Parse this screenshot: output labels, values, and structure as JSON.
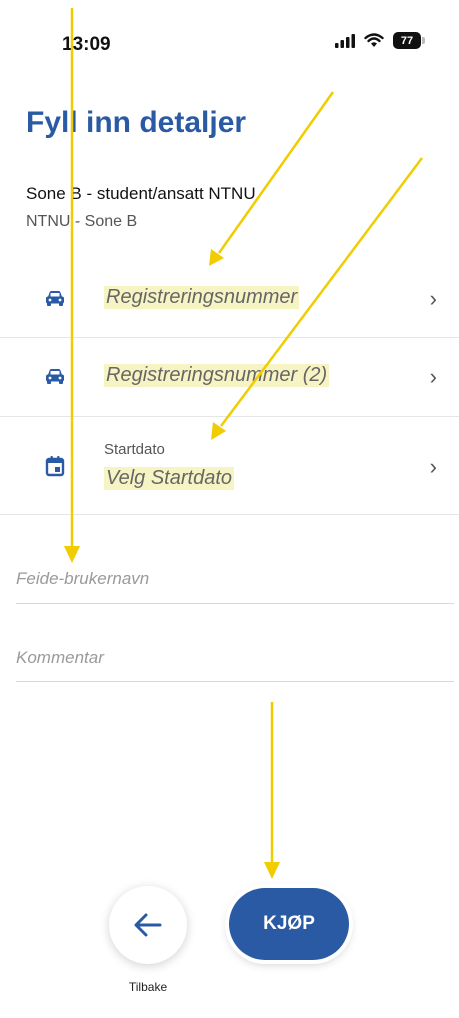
{
  "status_bar": {
    "time": "13:09",
    "battery": "77"
  },
  "page": {
    "title": "Fyll inn detaljer"
  },
  "zone": {
    "name": "Sone B - student/ansatt NTNU",
    "area": "NTNU - Sone B"
  },
  "rows": [
    {
      "icon": "car-icon",
      "value": "Registreringsnummer"
    },
    {
      "icon": "car-icon",
      "value": "Registreringsnummer (2)"
    },
    {
      "icon": "calendar-icon",
      "label": "Startdato",
      "value": "Velg Startdato"
    }
  ],
  "fields": {
    "feide_placeholder": "Feide-brukernavn",
    "comment_placeholder": "Kommentar"
  },
  "actions": {
    "back_label": "Tilbake",
    "buy_label": "KJØP"
  },
  "colors": {
    "accent": "#2b5aa4",
    "highlight": "#f7f4c4",
    "annotation": "#f0cc00"
  }
}
